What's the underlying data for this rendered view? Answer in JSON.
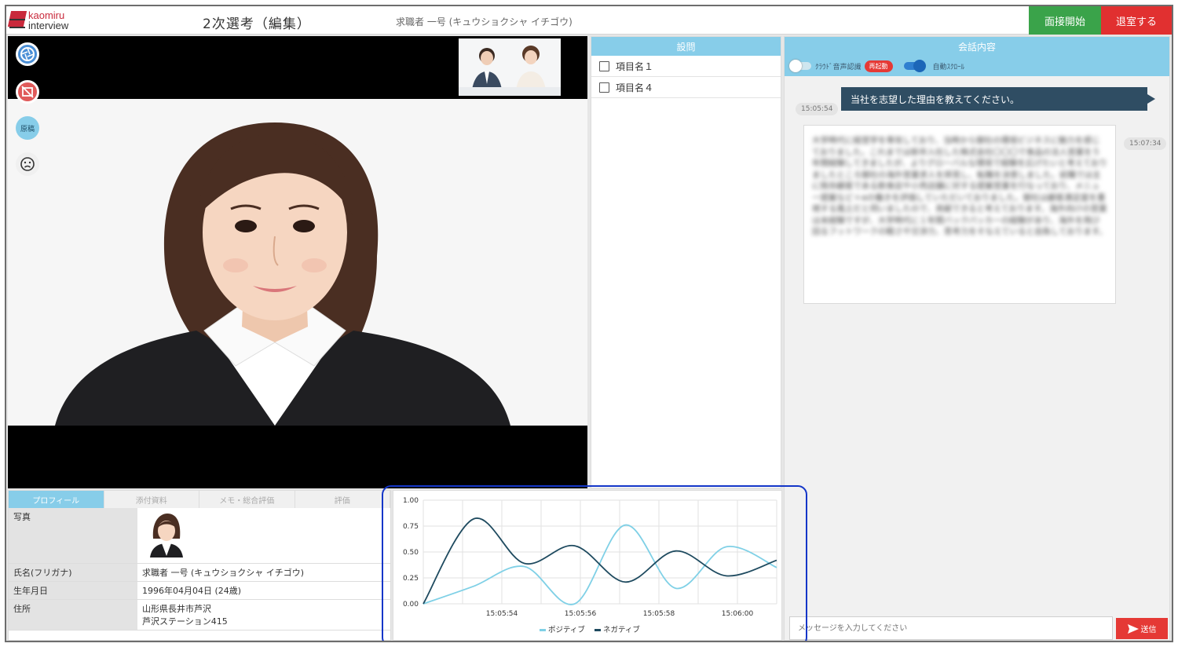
{
  "header": {
    "logo_top": "kaomiru",
    "logo_bottom": "interview",
    "title": "2次選考（編集）",
    "candidate": "求職者 一号 (キュウショクシャ イチゴウ)",
    "start_label": "面接開始",
    "leave_label": "退室する",
    "colors": {
      "start": "#3aa34a",
      "leave": "#e13030",
      "accent": "#87cde9"
    }
  },
  "video": {
    "controls": [
      {
        "icon": "camera-shutter-icon"
      },
      {
        "icon": "video-off-icon"
      },
      {
        "icon": "script-icon",
        "label": "原稿"
      },
      {
        "icon": "sad-face-icon"
      }
    ]
  },
  "questions": {
    "header": "設問",
    "items": [
      "項目名１",
      "項目名４"
    ]
  },
  "chat": {
    "header": "会話内容",
    "cloud_label": "ｸﾗｳﾄﾞ音声認識",
    "restart_label": "再起動",
    "autoscroll_label": "自動ｽｸﾛｰﾙ",
    "question_time": "15:05:54",
    "question_text": "当社を志望した理由を教えてください。",
    "answer_time": "15:07:34",
    "answer_text": "大学時代に経営学を専攻しており、当時から御社の環境ビジネスに魅力を感じておりました。これまでは新卒入社した株式会社〇〇〇で食品の法人営業を５年間経験してきましたが、よりグローバルな環境で経験を広げたいと考えておりましたところ御社の海外営業求人を拝見し、転職を決意しました。前職では主に既存顧客である飲食店や小売店舗に対する提案営業を行なっており、メニュー提案など＋αの働きを評価していただいておりました。御社は顧客満足度を重視する風土だと伺いましたので、貢献できると考えております。海外向けの営業は未経験ですが、大学時代に１年間バックパッカーの経験があり、海外を飛び回るフットワークの軽さや交渉力、思考力をそなえていると自負しております。",
    "input_placeholder": "メッセージを入力してください",
    "send_label": "送信"
  },
  "profile": {
    "tabs": [
      "プロフィール",
      "添付資料",
      "メモ・総合評価",
      "評価"
    ],
    "rows": [
      {
        "key": "写真",
        "value": ""
      },
      {
        "key": "氏名(フリガナ)",
        "value": "求職者 一号 (キュウショクシャ イチゴウ)"
      },
      {
        "key": "生年月日",
        "value": "1996年04月04日 (24歳)"
      },
      {
        "key": "住所",
        "value": "山形県長井市芦沢",
        "value2": "芦沢ステーション415"
      }
    ]
  },
  "chart_data": {
    "type": "line",
    "x_ticks": [
      "15:05:54",
      "15:05:56",
      "15:05:58",
      "15:06:00"
    ],
    "ylim": [
      0,
      1
    ],
    "y_ticks": [
      "0.00",
      "0.25",
      "0.50",
      "0.75",
      "1.00"
    ],
    "grid": true,
    "legend_position": "bottom",
    "series": [
      {
        "name": "ポジティブ",
        "color": "#7fd0e6",
        "x": [
          15.05,
          15.055,
          15.06,
          15.065,
          15.07,
          15.075,
          15.08,
          15.085
        ],
        "values": [
          0.0,
          0.17,
          0.36,
          0.0,
          0.76,
          0.15,
          0.55,
          0.35
        ]
      },
      {
        "name": "ネガティブ",
        "color": "#1e4a5f",
        "x": [
          15.05,
          15.055,
          15.06,
          15.065,
          15.07,
          15.075,
          15.08,
          15.085
        ],
        "values": [
          0.0,
          0.82,
          0.39,
          0.56,
          0.21,
          0.51,
          0.27,
          0.42
        ]
      }
    ]
  }
}
